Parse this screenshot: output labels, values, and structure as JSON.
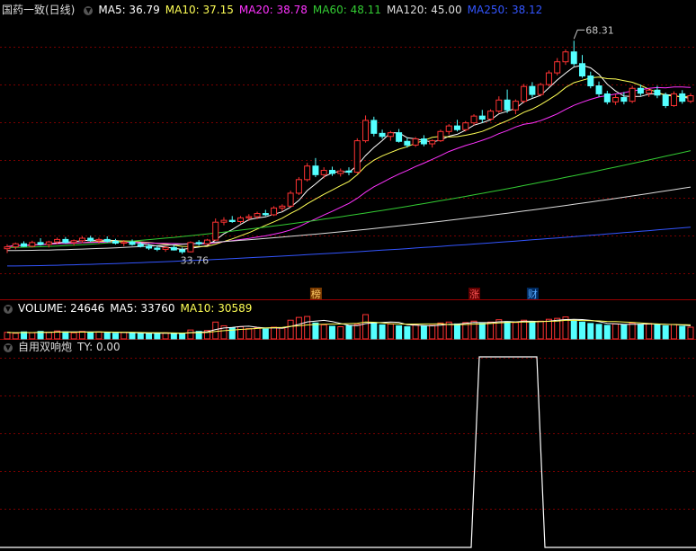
{
  "main_legend": {
    "stock_name": "国药一致(日线)",
    "items": [
      {
        "label": "MA5: 36.79",
        "color": "#ffffff"
      },
      {
        "label": "MA10: 37.15",
        "color": "#ffff55"
      },
      {
        "label": "MA20: 38.78",
        "color": "#ff33ff"
      },
      {
        "label": "MA60: 48.11",
        "color": "#33cc33"
      },
      {
        "label": "MA120: 45.00",
        "color": "#dddddd"
      },
      {
        "label": "MA250: 38.12",
        "color": "#3355ff"
      }
    ]
  },
  "volume_legend": {
    "items": [
      {
        "label": "VOLUME: 24646",
        "color": "#ffffff"
      },
      {
        "label": "MA5: 33760",
        "color": "#ffffff"
      },
      {
        "label": "MA10: 30589",
        "color": "#ffff55"
      }
    ]
  },
  "indicator_legend": {
    "items": [
      {
        "label": "自用双响炮",
        "color": "#dddddd"
      },
      {
        "label": "TY: 0.00",
        "color": "#dddddd"
      }
    ]
  },
  "annotations": {
    "high_label": "68.31",
    "low_label": "33.76",
    "event_markers": [
      "榜",
      "涨",
      "财"
    ]
  },
  "colors": {
    "up": "#ff3333",
    "down": "#54ffff",
    "grid": "#7a0000",
    "background": "#000000"
  },
  "chart_data": [
    {
      "type": "candlestick",
      "title": "国药一致(日线)",
      "high": 68.31,
      "low": 33.76,
      "candles_ohlc": [
        [
          34.6,
          35.3,
          33.9,
          34.9
        ],
        [
          34.9,
          35.6,
          34.5,
          35.4
        ],
        [
          35.4,
          35.8,
          34.9,
          35.0
        ],
        [
          35.0,
          35.9,
          34.8,
          35.6
        ],
        [
          35.6,
          36.3,
          35.1,
          35.3
        ],
        [
          35.3,
          35.9,
          34.8,
          35.7
        ],
        [
          35.7,
          36.4,
          35.3,
          36.1
        ],
        [
          36.1,
          36.5,
          35.4,
          35.6
        ],
        [
          35.6,
          36.1,
          35.1,
          35.9
        ],
        [
          35.9,
          36.6,
          35.5,
          36.3
        ],
        [
          36.3,
          36.7,
          35.7,
          35.9
        ],
        [
          35.9,
          36.4,
          35.4,
          36.1
        ],
        [
          36.1,
          36.6,
          35.6,
          35.8
        ],
        [
          35.8,
          36.2,
          35.3,
          35.5
        ],
        [
          35.5,
          36.0,
          35.0,
          35.7
        ],
        [
          35.7,
          36.1,
          35.1,
          35.3
        ],
        [
          35.3,
          35.7,
          34.8,
          35.0
        ],
        [
          35.0,
          35.4,
          34.4,
          34.7
        ],
        [
          34.7,
          35.1,
          34.2,
          34.5
        ],
        [
          34.5,
          35.0,
          34.1,
          34.8
        ],
        [
          34.8,
          35.2,
          34.3,
          34.4
        ],
        [
          34.4,
          34.8,
          33.76,
          34.1
        ],
        [
          34.1,
          35.8,
          34.0,
          35.6
        ],
        [
          35.6,
          36.0,
          35.1,
          35.4
        ],
        [
          35.4,
          36.2,
          35.2,
          36.0
        ],
        [
          36.0,
          39.5,
          35.9,
          38.9
        ],
        [
          38.9,
          39.7,
          38.4,
          39.2
        ],
        [
          39.2,
          39.9,
          38.8,
          39.0
        ],
        [
          39.0,
          39.9,
          38.7,
          39.6
        ],
        [
          39.6,
          40.2,
          39.1,
          39.8
        ],
        [
          39.8,
          40.6,
          39.4,
          40.3
        ],
        [
          40.3,
          40.9,
          39.9,
          40.1
        ],
        [
          40.1,
          41.5,
          39.9,
          41.2
        ],
        [
          41.2,
          41.8,
          40.7,
          41.5
        ],
        [
          41.5,
          44.0,
          41.3,
          43.6
        ],
        [
          43.6,
          46.2,
          43.3,
          45.8
        ],
        [
          45.8,
          48.5,
          45.5,
          48.0
        ],
        [
          48.0,
          49.3,
          46.2,
          46.6
        ],
        [
          46.6,
          47.8,
          46.0,
          47.3
        ],
        [
          47.3,
          47.9,
          46.4,
          46.8
        ],
        [
          46.8,
          47.6,
          46.3,
          47.2
        ],
        [
          47.2,
          47.8,
          46.5,
          47.0
        ],
        [
          47.0,
          52.5,
          46.8,
          52.1
        ],
        [
          52.1,
          56.2,
          51.8,
          55.4
        ],
        [
          55.4,
          56.0,
          52.8,
          53.3
        ],
        [
          53.3,
          53.9,
          52.4,
          52.8
        ],
        [
          52.8,
          53.7,
          52.1,
          53.4
        ],
        [
          53.4,
          54.0,
          51.8,
          52.0
        ],
        [
          52.0,
          52.6,
          51.0,
          51.4
        ],
        [
          51.4,
          52.7,
          51.1,
          52.4
        ],
        [
          52.4,
          53.0,
          51.2,
          51.6
        ],
        [
          51.6,
          52.3,
          51.0,
          52.1
        ],
        [
          52.1,
          53.9,
          51.9,
          53.6
        ],
        [
          53.6,
          54.8,
          53.1,
          54.5
        ],
        [
          54.5,
          55.5,
          53.6,
          53.9
        ],
        [
          53.9,
          55.3,
          53.6,
          55.0
        ],
        [
          55.0,
          56.4,
          54.6,
          56.1
        ],
        [
          56.1,
          57.1,
          55.0,
          55.6
        ],
        [
          55.6,
          57.2,
          55.3,
          56.9
        ],
        [
          56.9,
          59.3,
          56.6,
          58.7
        ],
        [
          58.7,
          60.4,
          56.6,
          57.1
        ],
        [
          57.1,
          58.8,
          56.4,
          58.5
        ],
        [
          58.5,
          61.3,
          58.2,
          60.9
        ],
        [
          60.9,
          61.6,
          59.1,
          59.6
        ],
        [
          59.6,
          61.5,
          59.3,
          61.2
        ],
        [
          61.2,
          63.5,
          60.9,
          63.1
        ],
        [
          63.1,
          65.5,
          62.7,
          64.9
        ],
        [
          64.9,
          66.9,
          64.4,
          66.5
        ],
        [
          66.5,
          68.31,
          64.2,
          64.6
        ],
        [
          64.6,
          66.0,
          62.3,
          62.6
        ],
        [
          62.6,
          63.3,
          60.6,
          61.0
        ],
        [
          61.0,
          61.7,
          59.2,
          59.7
        ],
        [
          59.7,
          60.2,
          58.0,
          58.4
        ],
        [
          58.4,
          59.6,
          57.9,
          59.1
        ],
        [
          59.1,
          60.0,
          58.0,
          58.5
        ],
        [
          58.5,
          61.0,
          58.2,
          60.6
        ],
        [
          60.6,
          61.2,
          59.4,
          59.8
        ],
        [
          59.8,
          60.6,
          59.2,
          60.3
        ],
        [
          60.3,
          61.0,
          59.0,
          59.5
        ],
        [
          59.5,
          59.9,
          57.4,
          57.8
        ],
        [
          57.8,
          60.1,
          57.6,
          59.7
        ],
        [
          59.7,
          60.3,
          58.1,
          58.5
        ],
        [
          58.5,
          59.8,
          58.2,
          59.4
        ]
      ],
      "ma_lines": [
        "MA5",
        "MA10",
        "MA20",
        "MA60",
        "MA120",
        "MA250"
      ]
    },
    {
      "type": "bar",
      "title": "VOLUME",
      "values": [
        14,
        12,
        15,
        13,
        16,
        14,
        17,
        15,
        13,
        16,
        14,
        15,
        13,
        12,
        14,
        13,
        12,
        11,
        12,
        13,
        12,
        11,
        19,
        16,
        18,
        36,
        28,
        24,
        26,
        22,
        24,
        21,
        25,
        23,
        40,
        46,
        48,
        34,
        30,
        27,
        26,
        28,
        31,
        52,
        35,
        30,
        32,
        28,
        26,
        30,
        27,
        29,
        34,
        36,
        32,
        35,
        38,
        33,
        36,
        41,
        37,
        35,
        40,
        36,
        38,
        42,
        44,
        47,
        38,
        36,
        33,
        31,
        29,
        32,
        30,
        34,
        31,
        33,
        30,
        28,
        31,
        27,
        25
      ]
    },
    {
      "type": "line",
      "title": "自用双响炮",
      "series": [
        {
          "name": "TY",
          "values": [
            0,
            1,
            0
          ]
        }
      ],
      "note_levels": "0 or 1 step signal"
    }
  ]
}
